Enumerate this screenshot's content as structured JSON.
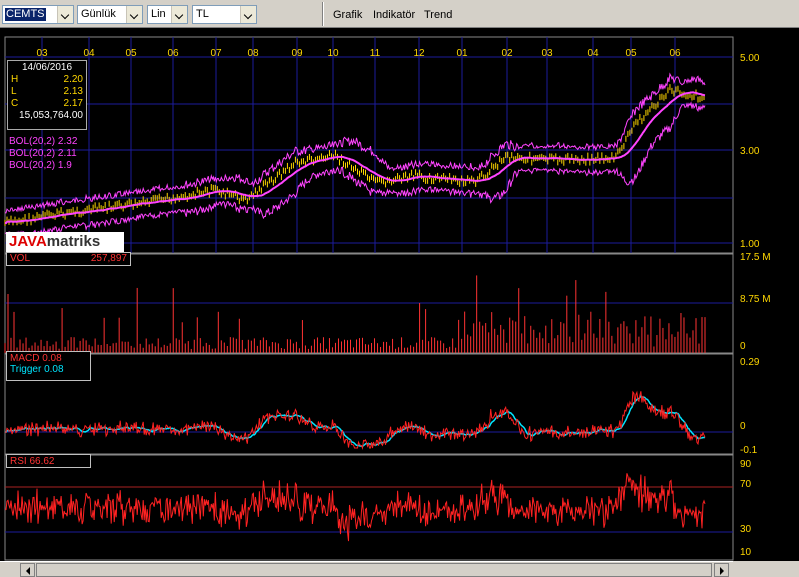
{
  "toolbar": {
    "symbol": "CEMTS",
    "period": "Günlük",
    "scale": "Lin",
    "currency": "TL",
    "menu": [
      "Grafik",
      "Indikatör",
      "Trend"
    ]
  },
  "ohlc": {
    "date": "14/06/2016",
    "h_label": "H",
    "h_value": "2.20",
    "l_label": "L",
    "l_value": "2.13",
    "c_label": "C",
    "c_value": "2.17",
    "volume": "15,053,764.00"
  },
  "bollinger": [
    "BOL(20,2) 2.32",
    "BOL(20,2) 2.11",
    "BOL(20,2) 1.9"
  ],
  "logo": {
    "part1": "JAVA",
    "part2": "matriks"
  },
  "volume_panel": {
    "label": "VOL",
    "value": "257,897"
  },
  "macd_panel": {
    "macd": "MACD 0.08",
    "trigger": "Trigger 0.08"
  },
  "rsi_panel": {
    "label": "RSI 66.62"
  },
  "axes": {
    "months": [
      "03",
      "04",
      "05",
      "06",
      "07",
      "08",
      "09",
      "10",
      "11",
      "12",
      "01",
      "02",
      "03",
      "04",
      "05",
      "06"
    ],
    "price_ticks": [
      "5.00",
      "3.00",
      "1.00"
    ],
    "vol_ticks": [
      "17.5 M",
      "8.75 M",
      "0"
    ],
    "macd_ticks": [
      "0.29",
      "0",
      "-0.1"
    ],
    "rsi_ticks": [
      "90",
      "70",
      "30",
      "10"
    ]
  },
  "colors": {
    "price": "#ffd700",
    "bollinger": "#ff44ff",
    "average": "#ff44ff",
    "volume": "#ff3333",
    "macd": "#ff2222",
    "trigger": "#00e5ff",
    "rsi": "#ff2222",
    "grid": "#1c1c9c"
  }
}
